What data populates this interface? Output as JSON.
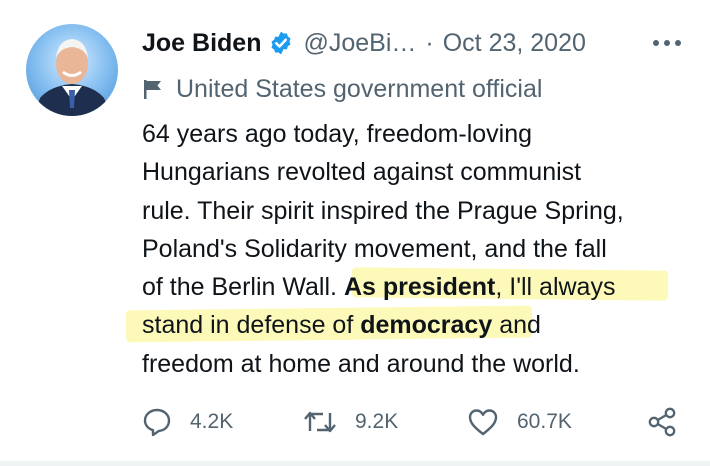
{
  "tweet": {
    "author": {
      "name": "Joe Biden",
      "handle": "@JoeBi…",
      "verified": true,
      "label": "United States government official"
    },
    "separator": "·",
    "date": "Oct 23, 2020",
    "text_lines": [
      [
        "64 years ago today, freedom-loving"
      ],
      [
        "Hungarians revolted against communist"
      ],
      [
        "rule. Their spirit inspired the Prague Spring,"
      ],
      [
        "Poland's Solidarity movement, and the fall"
      ],
      [
        "of the Berlin Wall. ",
        "As president",
        ", I'll always"
      ],
      [
        "stand in defense of ",
        "democracy",
        " and"
      ],
      [
        "freedom at home and around the world."
      ]
    ],
    "stats": {
      "replies": "4.2K",
      "retweets": "9.2K",
      "likes": "60.7K"
    }
  },
  "colors": {
    "text": "#0f1419",
    "secondary": "#536471",
    "verified_blue": "#1d9bf0",
    "highlight": "#fdf9b8"
  },
  "icons": [
    "more-icon",
    "verified-badge-icon",
    "flag-icon",
    "reply-icon",
    "retweet-icon",
    "like-icon",
    "share-icon"
  ]
}
